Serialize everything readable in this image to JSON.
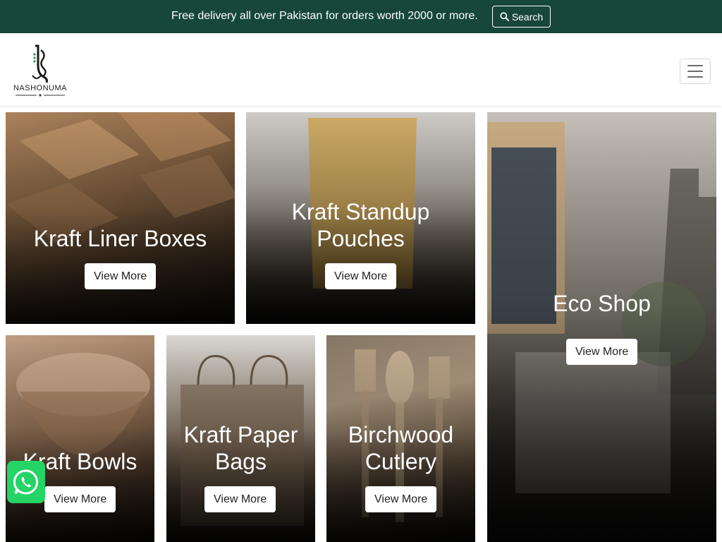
{
  "topbar": {
    "message": "Free delivery all over Pakistan for orders worth 2000 or more.",
    "search_label": "Search",
    "search_icon": "search-icon",
    "bg_color": "#17463b"
  },
  "header": {
    "logo_text": "NASHONUMA",
    "menu_icon": "hamburger-menu-icon"
  },
  "tiles": [
    {
      "title_line1": "Kraft Liner Boxes",
      "button_label": "View More"
    },
    {
      "title_line1": "Kraft Standup",
      "title_line2": "Pouches",
      "button_label": "View More"
    },
    {
      "title_line1": "Eco Shop",
      "button_label": "View More"
    },
    {
      "title_line1": "Kraft Bowls",
      "button_label": "View More"
    },
    {
      "title_line1": "Kraft Paper",
      "title_line2": "Bags",
      "button_label": "View More"
    },
    {
      "title_line1": "Birchwood",
      "title_line2": "Cutlery",
      "button_label": "View More"
    }
  ],
  "floating": {
    "whatsapp_icon": "whatsapp-icon",
    "whatsapp_color": "#25d366"
  }
}
